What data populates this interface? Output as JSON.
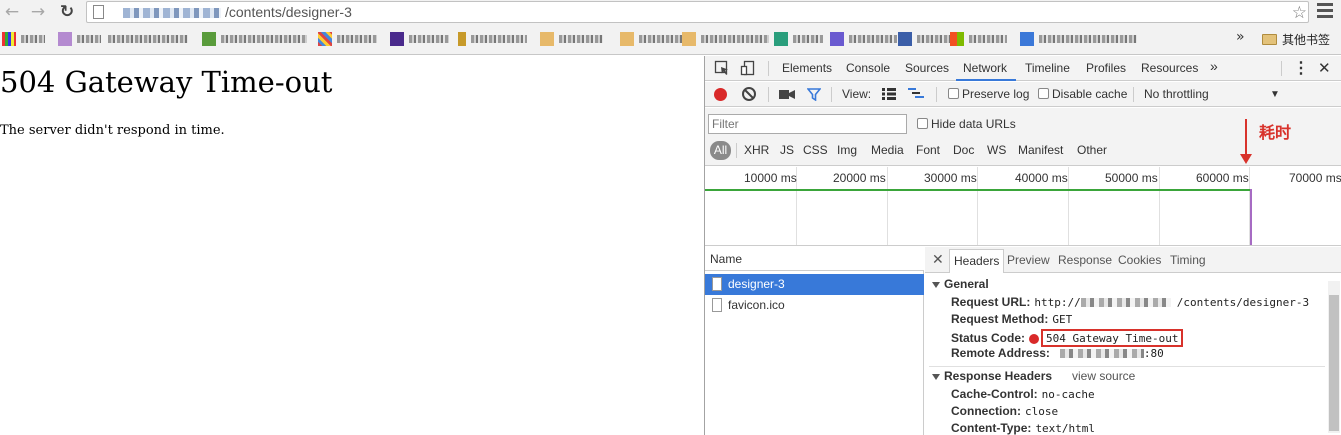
{
  "browser": {
    "url_suffix": "/contents/designer-3",
    "bookmarks_more": "»",
    "other_bookmarks": "其他书签"
  },
  "page": {
    "heading": "504 Gateway Time-out",
    "message": "The server didn't respond in time."
  },
  "devtools": {
    "tabs": [
      "Elements",
      "Console",
      "Sources",
      "Network",
      "Timeline",
      "Profiles",
      "Resources"
    ],
    "active_tab": "Network",
    "more_tabs": "»",
    "toolbar": {
      "view_label": "View:",
      "preserve_log": "Preserve log",
      "disable_cache": "Disable cache",
      "throttling": "No throttling",
      "throttling_arrow": "▼"
    },
    "filter_placeholder": "Filter",
    "hide_data_urls": "Hide data URLs",
    "filter_types": [
      "All",
      "XHR",
      "JS",
      "CSS",
      "Img",
      "Media",
      "Font",
      "Doc",
      "WS",
      "Manifest",
      "Other"
    ],
    "timeline_ticks": [
      "10000 ms",
      "20000 ms",
      "30000 ms",
      "40000 ms",
      "50000 ms",
      "60000 ms",
      "70000 ms"
    ],
    "annotation": "耗时",
    "name_header": "Name",
    "requests": [
      {
        "name": "designer-3",
        "selected": true
      },
      {
        "name": "favicon.ico",
        "selected": false
      }
    ],
    "detail_tabs": [
      "Headers",
      "Preview",
      "Response",
      "Cookies",
      "Timing"
    ],
    "active_detail_tab": "Headers",
    "general": {
      "title": "General",
      "request_url_label": "Request URL:",
      "request_url_prefix": "http://",
      "request_url_suffix": "/contents/designer-3",
      "request_method_label": "Request Method:",
      "request_method": "GET",
      "status_code_label": "Status Code:",
      "status_code": "504 Gateway Time-out",
      "remote_address_label": "Remote Address:",
      "remote_address_suffix": ":80"
    },
    "response_headers": {
      "title": "Response Headers",
      "view_source": "view source",
      "rows": [
        {
          "key": "Cache-Control:",
          "value": "no-cache"
        },
        {
          "key": "Connection:",
          "value": "close"
        },
        {
          "key": "Content-Type:",
          "value": "text/html"
        }
      ]
    }
  },
  "colors": {
    "accent": "#3879d9",
    "record": "#d92929",
    "annotation": "#d8322b",
    "timeline_green": "#3aa53a",
    "timeline_purple": "#a66bc3"
  },
  "icons": {
    "back": "back-arrow-icon",
    "forward": "forward-arrow-icon",
    "reload": "reload-icon",
    "star": "star-icon",
    "menu": "hamburger-menu-icon"
  }
}
